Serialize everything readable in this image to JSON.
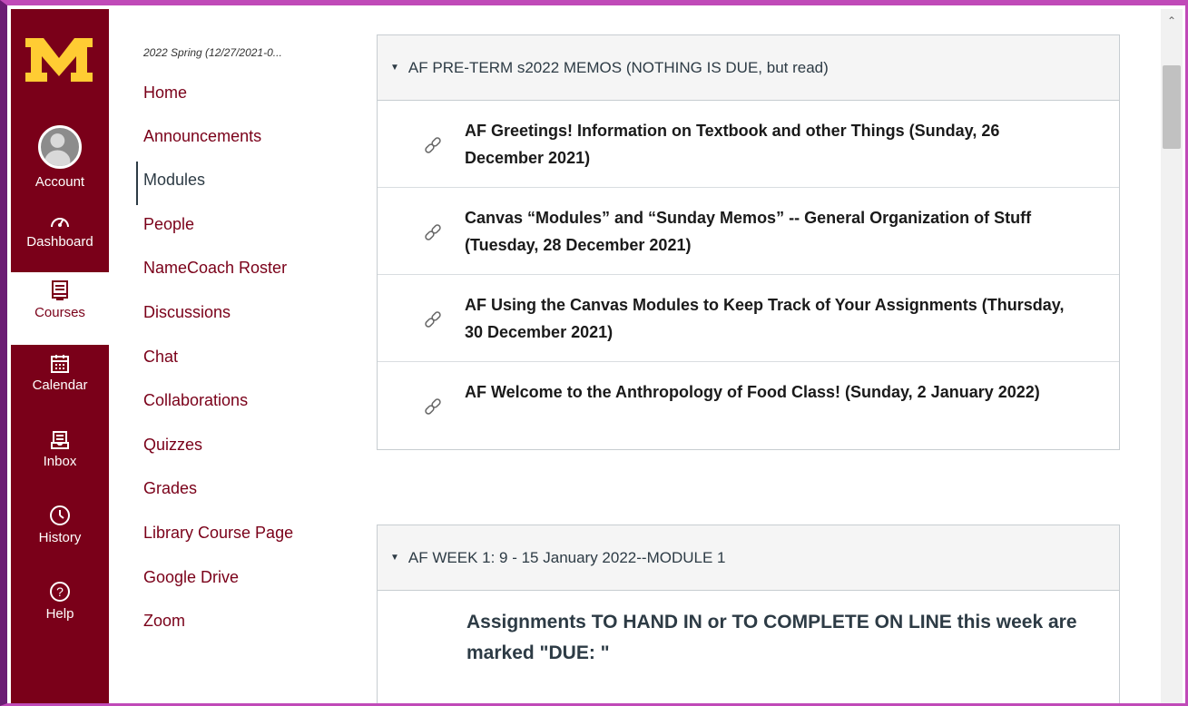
{
  "global_nav": {
    "account": "Account",
    "dashboard": "Dashboard",
    "courses": "Courses",
    "calendar": "Calendar",
    "inbox": "Inbox",
    "history": "History",
    "help": "Help"
  },
  "course_nav": {
    "term": "2022 Spring (12/27/2021-0...",
    "items": [
      {
        "label": "Home"
      },
      {
        "label": "Announcements"
      },
      {
        "label": "Modules"
      },
      {
        "label": "People"
      },
      {
        "label": "NameCoach Roster"
      },
      {
        "label": "Discussions"
      },
      {
        "label": "Chat"
      },
      {
        "label": "Collaborations"
      },
      {
        "label": "Quizzes"
      },
      {
        "label": "Grades"
      },
      {
        "label": "Library Course Page"
      },
      {
        "label": "Google Drive"
      },
      {
        "label": "Zoom"
      }
    ]
  },
  "modules": [
    {
      "title": "AF PRE-TERM s2022 MEMOS (NOTHING IS DUE, but read)",
      "items": [
        {
          "title": "AF Greetings! Information on Textbook and other Things (Sunday, 26 December 2021)"
        },
        {
          "title": "Canvas “Modules” and “Sunday Memos” -- General Organization of Stuff (Tuesday, 28 December 2021)"
        },
        {
          "title": "AF Using the Canvas Modules to Keep Track of Your Assignments (Thursday, 30 December 2021)"
        },
        {
          "title": "AF Welcome to the Anthropology of Food Class! (Sunday, 2 January 2022)"
        }
      ]
    },
    {
      "title": "AF WEEK 1: 9 - 15 January 2022--MODULE 1",
      "items": [
        {
          "title": "Assignments TO HAND IN or TO COMPLETE ON LINE this week are marked \"DUE: \""
        }
      ]
    }
  ],
  "colors": {
    "brand_maroon": "#7a0019",
    "brand_gold": "#ffcc33",
    "frame_purple": "#c04ab8"
  }
}
